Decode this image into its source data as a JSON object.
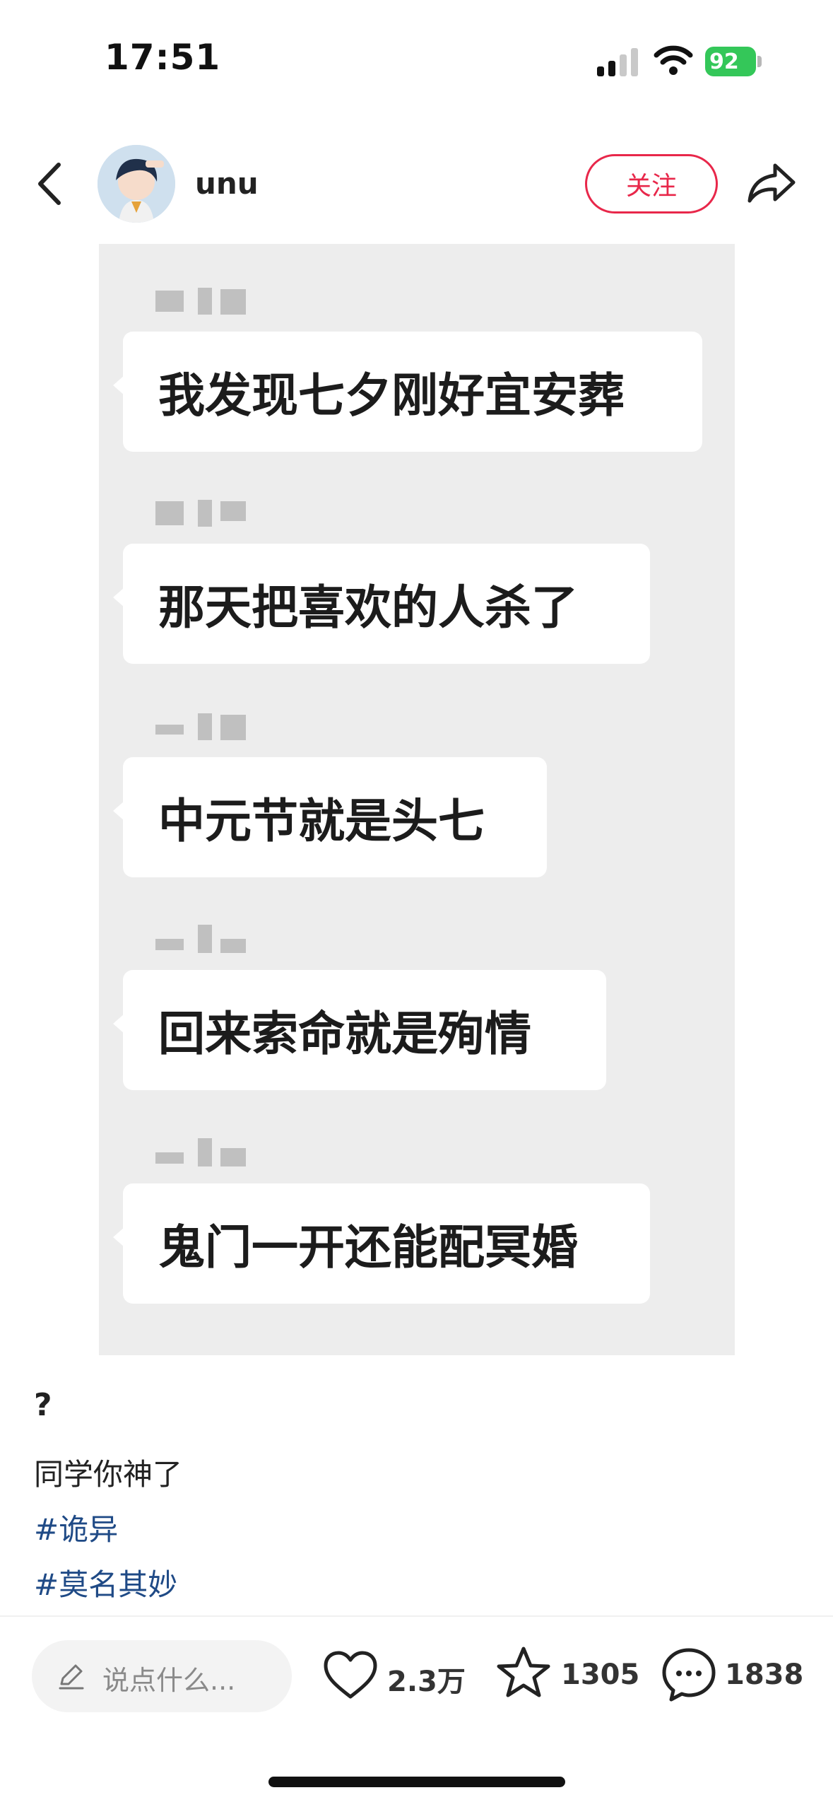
{
  "status_bar": {
    "time": "17:51",
    "battery": "92"
  },
  "header": {
    "username": "unu",
    "follow_label": "关注"
  },
  "chat": {
    "messages": [
      {
        "text": "我发现七夕刚好宜安葬"
      },
      {
        "text": "那天把喜欢的人杀了"
      },
      {
        "text": "中元节就是头七"
      },
      {
        "text": "回来索命就是殉情"
      },
      {
        "text": "鬼门一开还能配冥婚"
      }
    ]
  },
  "caption": {
    "title": "?",
    "text": "同学你神了",
    "tags": [
      "#诡异",
      "#莫名其妙"
    ]
  },
  "bottom_bar": {
    "comment_placeholder": "说点什么...",
    "likes": "2.3万",
    "favorites": "1305",
    "comments": "1838"
  },
  "colors": {
    "accent": "#e8274a",
    "tag": "#1f4a86",
    "battery": "#34c759"
  }
}
